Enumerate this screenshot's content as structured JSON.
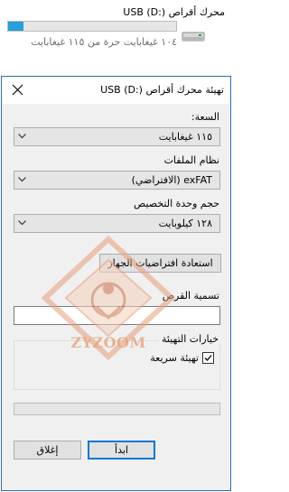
{
  "drive_tile": {
    "name": "محرك أقراص USB (D:)",
    "space_text": "١٠٤ غيغابايت حرة من ١١٥ غيغابايت",
    "used_fraction": 0.09,
    "icon": "usb-drive-icon"
  },
  "dialog": {
    "title": "تهيئة محرك أقراص USB (D:)",
    "close_icon": "close-icon",
    "capacity": {
      "label": "السعة:",
      "value": "١١٥ غيغابايت"
    },
    "file_system": {
      "label": "نظام الملفات",
      "value": "exFAT (الافتراضي)"
    },
    "allocation": {
      "label": "حجم وحدة التخصيص",
      "value": "١٢٨ كيلوبايت"
    },
    "restore_defaults_label": "استعادة افتراضيات الجهاز",
    "volume_label": {
      "label": "تسمية القرص",
      "value": ""
    },
    "format_options": {
      "legend": "خيارات التهيئة",
      "quick_format_label": "تهيئة سريعة",
      "quick_format_checked": true
    },
    "progress_fraction": 0.0,
    "start_label": "ابدأ",
    "close_label": "إغلاق"
  },
  "watermark": {
    "text": "ZYZOOM"
  },
  "colors": {
    "accent": "#0078d7",
    "drive_bar": "#26a0da",
    "dialog_bg": "#f0f0f0",
    "watermark": "#e8a27a"
  }
}
